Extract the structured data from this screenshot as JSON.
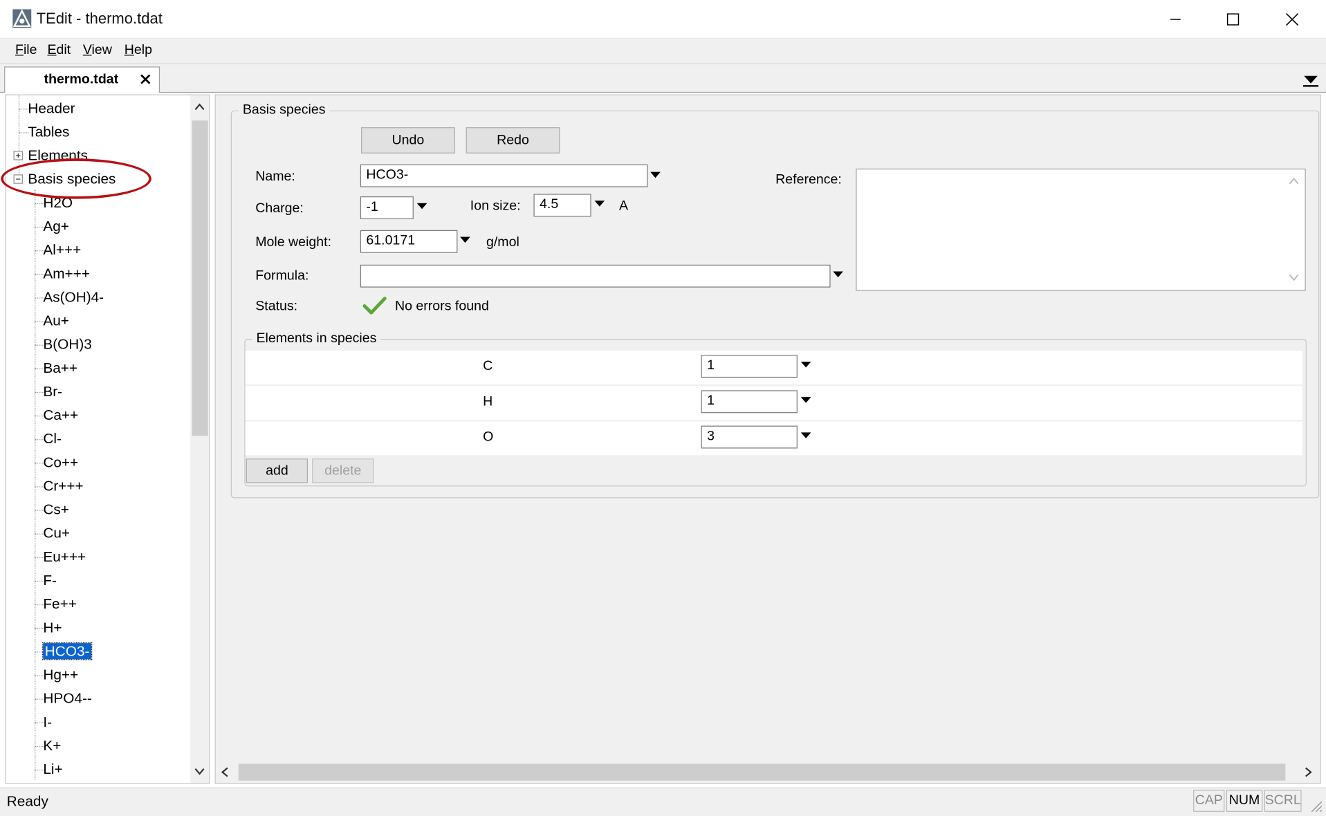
{
  "window": {
    "title": "TEdit - thermo.tdat",
    "app_icon": "tedit-app-icon",
    "controls": {
      "minimize": "minimize-icon",
      "maximize": "maximize-icon",
      "close": "close-icon"
    }
  },
  "menu": {
    "file": {
      "mnemonic": "F",
      "rest": "ile"
    },
    "edit": {
      "mnemonic": "E",
      "rest": "dit"
    },
    "view": {
      "mnemonic": "V",
      "rest": "iew"
    },
    "help": {
      "mnemonic": "H",
      "rest": "elp"
    }
  },
  "tabs": [
    {
      "label": "thermo.tdat",
      "active": true
    }
  ],
  "tree": {
    "top_items": [
      "Header",
      "Tables",
      "Elements",
      "Basis species"
    ],
    "species": [
      "H2O",
      "Ag+",
      "Al+++",
      "Am+++",
      "As(OH)4-",
      "Au+",
      "B(OH)3",
      "Ba++",
      "Br-",
      "Ca++",
      "Cl-",
      "Co++",
      "Cr+++",
      "Cs+",
      "Cu+",
      "Eu+++",
      "F-",
      "Fe++",
      "H+",
      "HCO3-",
      "Hg++",
      "HPO4--",
      "I-",
      "K+",
      "Li+"
    ],
    "selected": "HCO3-"
  },
  "basis": {
    "group_title": "Basis species",
    "undo_label": "Undo",
    "redo_label": "Redo",
    "name_label": "Name:",
    "name_value": "HCO3-",
    "charge_label": "Charge:",
    "charge_value": "-1",
    "ion_size_label": "Ion size:",
    "ion_size_value": "4.5",
    "ion_size_unit": "A",
    "mole_weight_label": "Mole weight:",
    "mole_weight_value": "61.0171",
    "mole_weight_unit": "g/mol",
    "formula_label": "Formula:",
    "formula_value": "",
    "status_label": "Status:",
    "status_value": "No errors found",
    "status_color": "#5aa839",
    "reference_label": "Reference:",
    "reference_value": ""
  },
  "elements": {
    "group_title": "Elements in species",
    "rows": [
      {
        "element": "C",
        "count": "1"
      },
      {
        "element": "H",
        "count": "1"
      },
      {
        "element": "O",
        "count": "3"
      }
    ],
    "add_label": "add",
    "delete_label": "delete"
  },
  "statusbar": {
    "text": "Ready",
    "cap": "CAP",
    "num": "NUM",
    "scrl": "SCRL"
  },
  "colors": {
    "selection": "#0a64d0",
    "annotation_ellipse": "#b80f14"
  }
}
